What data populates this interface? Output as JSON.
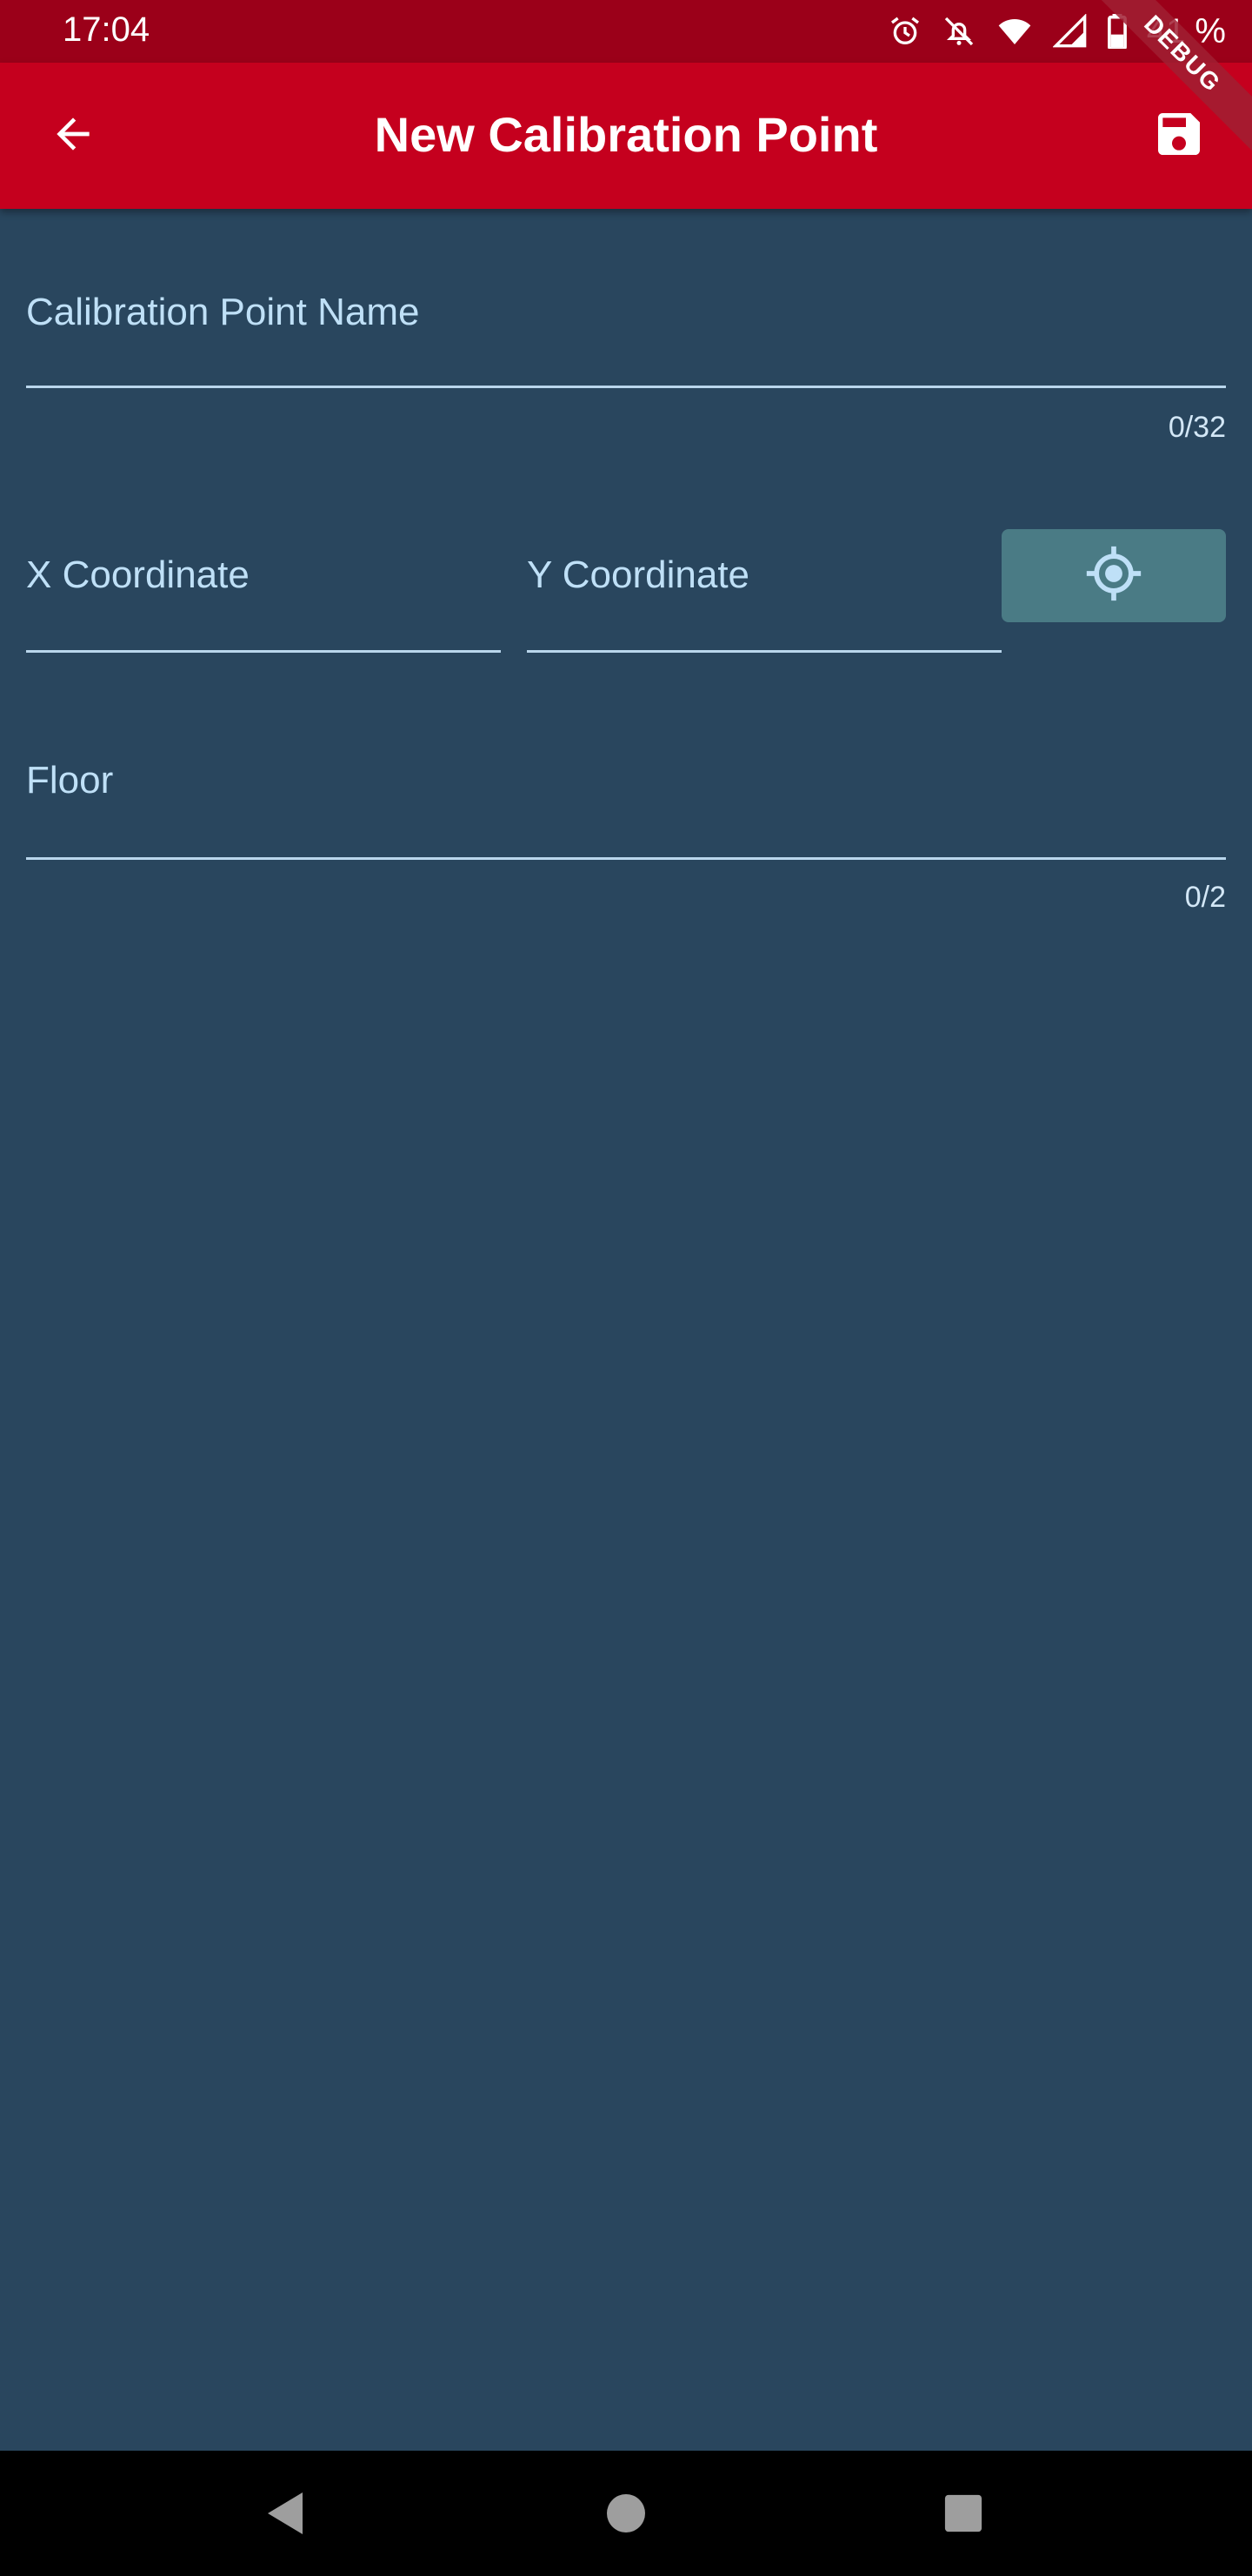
{
  "status_bar": {
    "time": "17:04",
    "battery": "41 %"
  },
  "debug_banner": "DEBUG",
  "app_bar": {
    "title": "New Calibration Point",
    "back_icon": "arrow-back-icon",
    "save_icon": "save-icon"
  },
  "form": {
    "name": {
      "label": "Calibration Point Name",
      "value": "",
      "counter": "0/32"
    },
    "x": {
      "label": "X Coordinate",
      "value": ""
    },
    "y": {
      "label": "Y Coordinate",
      "value": ""
    },
    "locate_icon": "gps-target-icon",
    "floor": {
      "label": "Floor",
      "value": "",
      "counter": "0/2"
    }
  },
  "colors": {
    "status_bar": "#9b0019",
    "app_bar": "#c5001e",
    "background": "#29465e",
    "accent_button": "#4a7b85",
    "label": "#bfe0f7"
  }
}
